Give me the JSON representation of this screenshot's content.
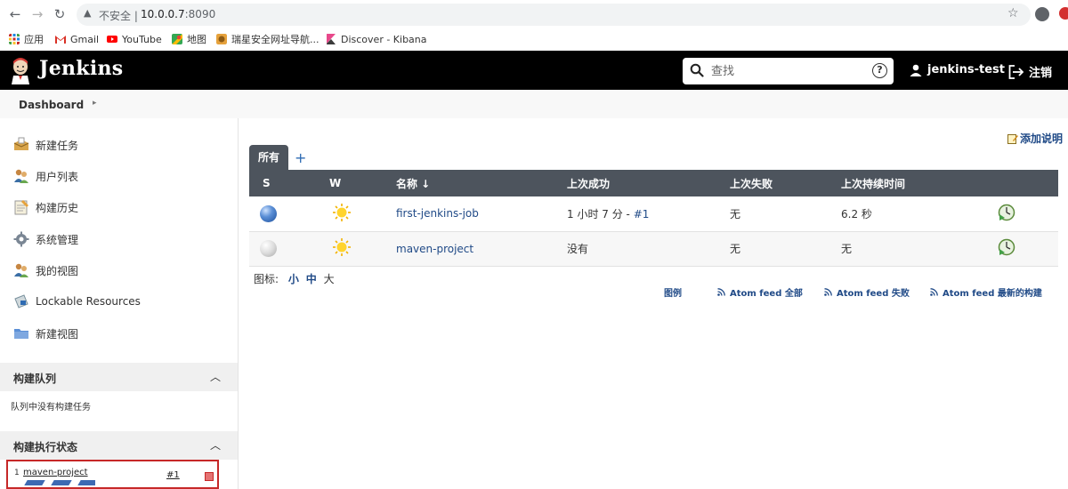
{
  "browser": {
    "insecure_label": "不安全",
    "separator": "|",
    "url_host": "10.0.0.7",
    "url_port": ":8090"
  },
  "bookmarks": [
    {
      "label": "应用",
      "icon": "apps-grid-icon",
      "color": "#c62828"
    },
    {
      "label": "Gmail",
      "icon": "gmail-icon",
      "color": "#d93025"
    },
    {
      "label": "YouTube",
      "icon": "youtube-icon",
      "color": "#ff0000"
    },
    {
      "label": "地图",
      "icon": "maps-icon",
      "color": "#34a853"
    },
    {
      "label": "瑞星安全网址导航...",
      "icon": "rising-lion-icon",
      "color": "#e6a23c"
    },
    {
      "label": "Discover - Kibana",
      "icon": "kibana-icon",
      "color": "#e8488b"
    }
  ],
  "header": {
    "brand": "Jenkins",
    "search_placeholder": "查找",
    "help_label": "?",
    "user": "jenkins-test",
    "logout": "注销"
  },
  "breadcrumb": {
    "item": "Dashboard",
    "caret": "▸"
  },
  "sidebar": {
    "tasks": [
      {
        "label": "新建任务",
        "icon": "new-item-icon"
      },
      {
        "label": "用户列表",
        "icon": "people-icon"
      },
      {
        "label": "构建历史",
        "icon": "notepad-icon"
      },
      {
        "label": "系统管理",
        "icon": "gear-icon"
      },
      {
        "label": "我的视图",
        "icon": "people-icon"
      },
      {
        "label": "Lockable Resources",
        "icon": "lock-resource-icon"
      },
      {
        "label": "新建视图",
        "icon": "folder-icon"
      }
    ],
    "build_queue": {
      "title": "构建队列",
      "empty_text": "队列中没有构建任务"
    },
    "executors": {
      "title": "构建执行状态",
      "rows": [
        {
          "number": "1",
          "job": "maven-project",
          "build": "#1"
        }
      ]
    }
  },
  "main": {
    "add_description": "添加说明",
    "tabs": [
      {
        "label": "所有"
      }
    ],
    "tab_add": "+",
    "table": {
      "headers": [
        "S",
        "W",
        "名称 ↓",
        "上次成功",
        "上次失败",
        "上次持续时间"
      ],
      "rows": [
        {
          "status": "blue",
          "weather": "sunny",
          "name": "first-jenkins-job",
          "last_success_text": "1 小时 7 分 - ",
          "last_success_build": "#1",
          "last_failure": "无",
          "last_duration": "6.2 秒"
        },
        {
          "status": "grey",
          "weather": "sunny",
          "name": "maven-project",
          "last_success_text": "没有",
          "last_success_build": "",
          "last_failure": "无",
          "last_duration": "无"
        }
      ]
    },
    "icon_size": {
      "label": "图标:",
      "small": "小",
      "medium": "中",
      "large": "大"
    },
    "footer_links": [
      {
        "label": "图例",
        "rss": false
      },
      {
        "label": "Atom feed 全部",
        "rss": true
      },
      {
        "label": "Atom feed 失败",
        "rss": true
      },
      {
        "label": "Atom feed 最新的构建",
        "rss": true
      }
    ]
  },
  "colors": {
    "header_bg": "#000000",
    "table_header_bg": "#4d545d",
    "link": "#204a87",
    "executor_highlight": "#c62828"
  }
}
